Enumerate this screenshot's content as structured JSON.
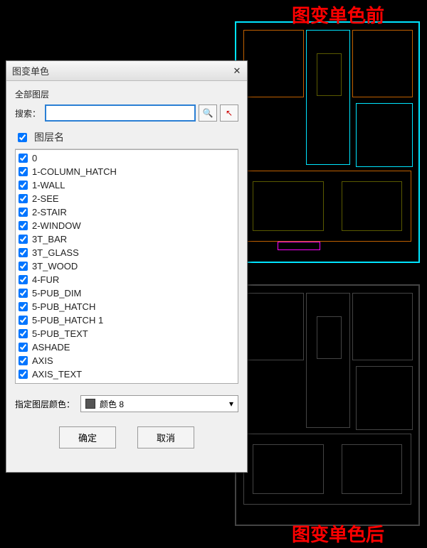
{
  "annotations": {
    "before": "图变单色前",
    "after": "图变单色后"
  },
  "dialog": {
    "title": "图变单色",
    "close_glyph": "✕",
    "all_layers_label": "全部图层",
    "search_label": "搜索：",
    "search_placeholder": "",
    "search_icon": "🔍",
    "pick_icon": "⬚",
    "header_chk_checked": true,
    "header_col": "图层名",
    "layers": [
      "0",
      "1-COLUMN_HATCH",
      "1-WALL",
      "2-SEE",
      "2-STAIR",
      "2-WINDOW",
      "3T_BAR",
      "3T_GLASS",
      "3T_WOOD",
      "4-FUR",
      "5-PUB_DIM",
      "5-PUB_HATCH",
      "5-PUB_HATCH 1",
      "5-PUB_TEXT",
      "ASHADE",
      "AXIS",
      "AXIS_TEXT"
    ],
    "color_label": "指定图层颜色：",
    "color_name": "颜色 8",
    "color_hex": "#555555",
    "ok_label": "确定",
    "cancel_label": "取消"
  }
}
